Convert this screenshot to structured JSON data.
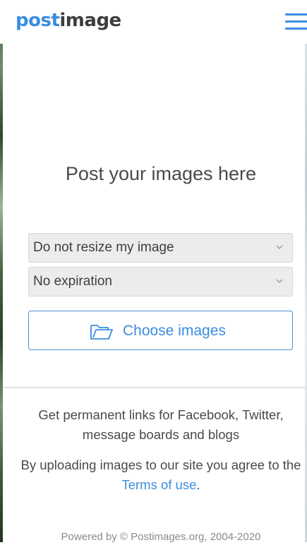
{
  "header": {
    "logo_part1": "post",
    "logo_part2": "image",
    "menu_icon": "hamburger-menu-icon",
    "accent_color": "#3a8de0"
  },
  "main": {
    "headline": "Post your images here",
    "resize_select": {
      "selected": "Do not resize my image",
      "icon": "chevron-down-icon"
    },
    "expiration_select": {
      "selected": "No expiration",
      "icon": "chevron-down-icon"
    },
    "choose_button": {
      "label": "Choose images",
      "icon": "folder-open-icon"
    }
  },
  "info": {
    "line1": "Get permanent links for Facebook, Twitter,",
    "line2": "message boards and blogs",
    "agree_text": "By uploading images to our site you agree to the",
    "terms_link": "Terms of use",
    "terms_suffix": "."
  },
  "footer": {
    "text": "Powered by © Postimages.org, 2004-2020"
  }
}
